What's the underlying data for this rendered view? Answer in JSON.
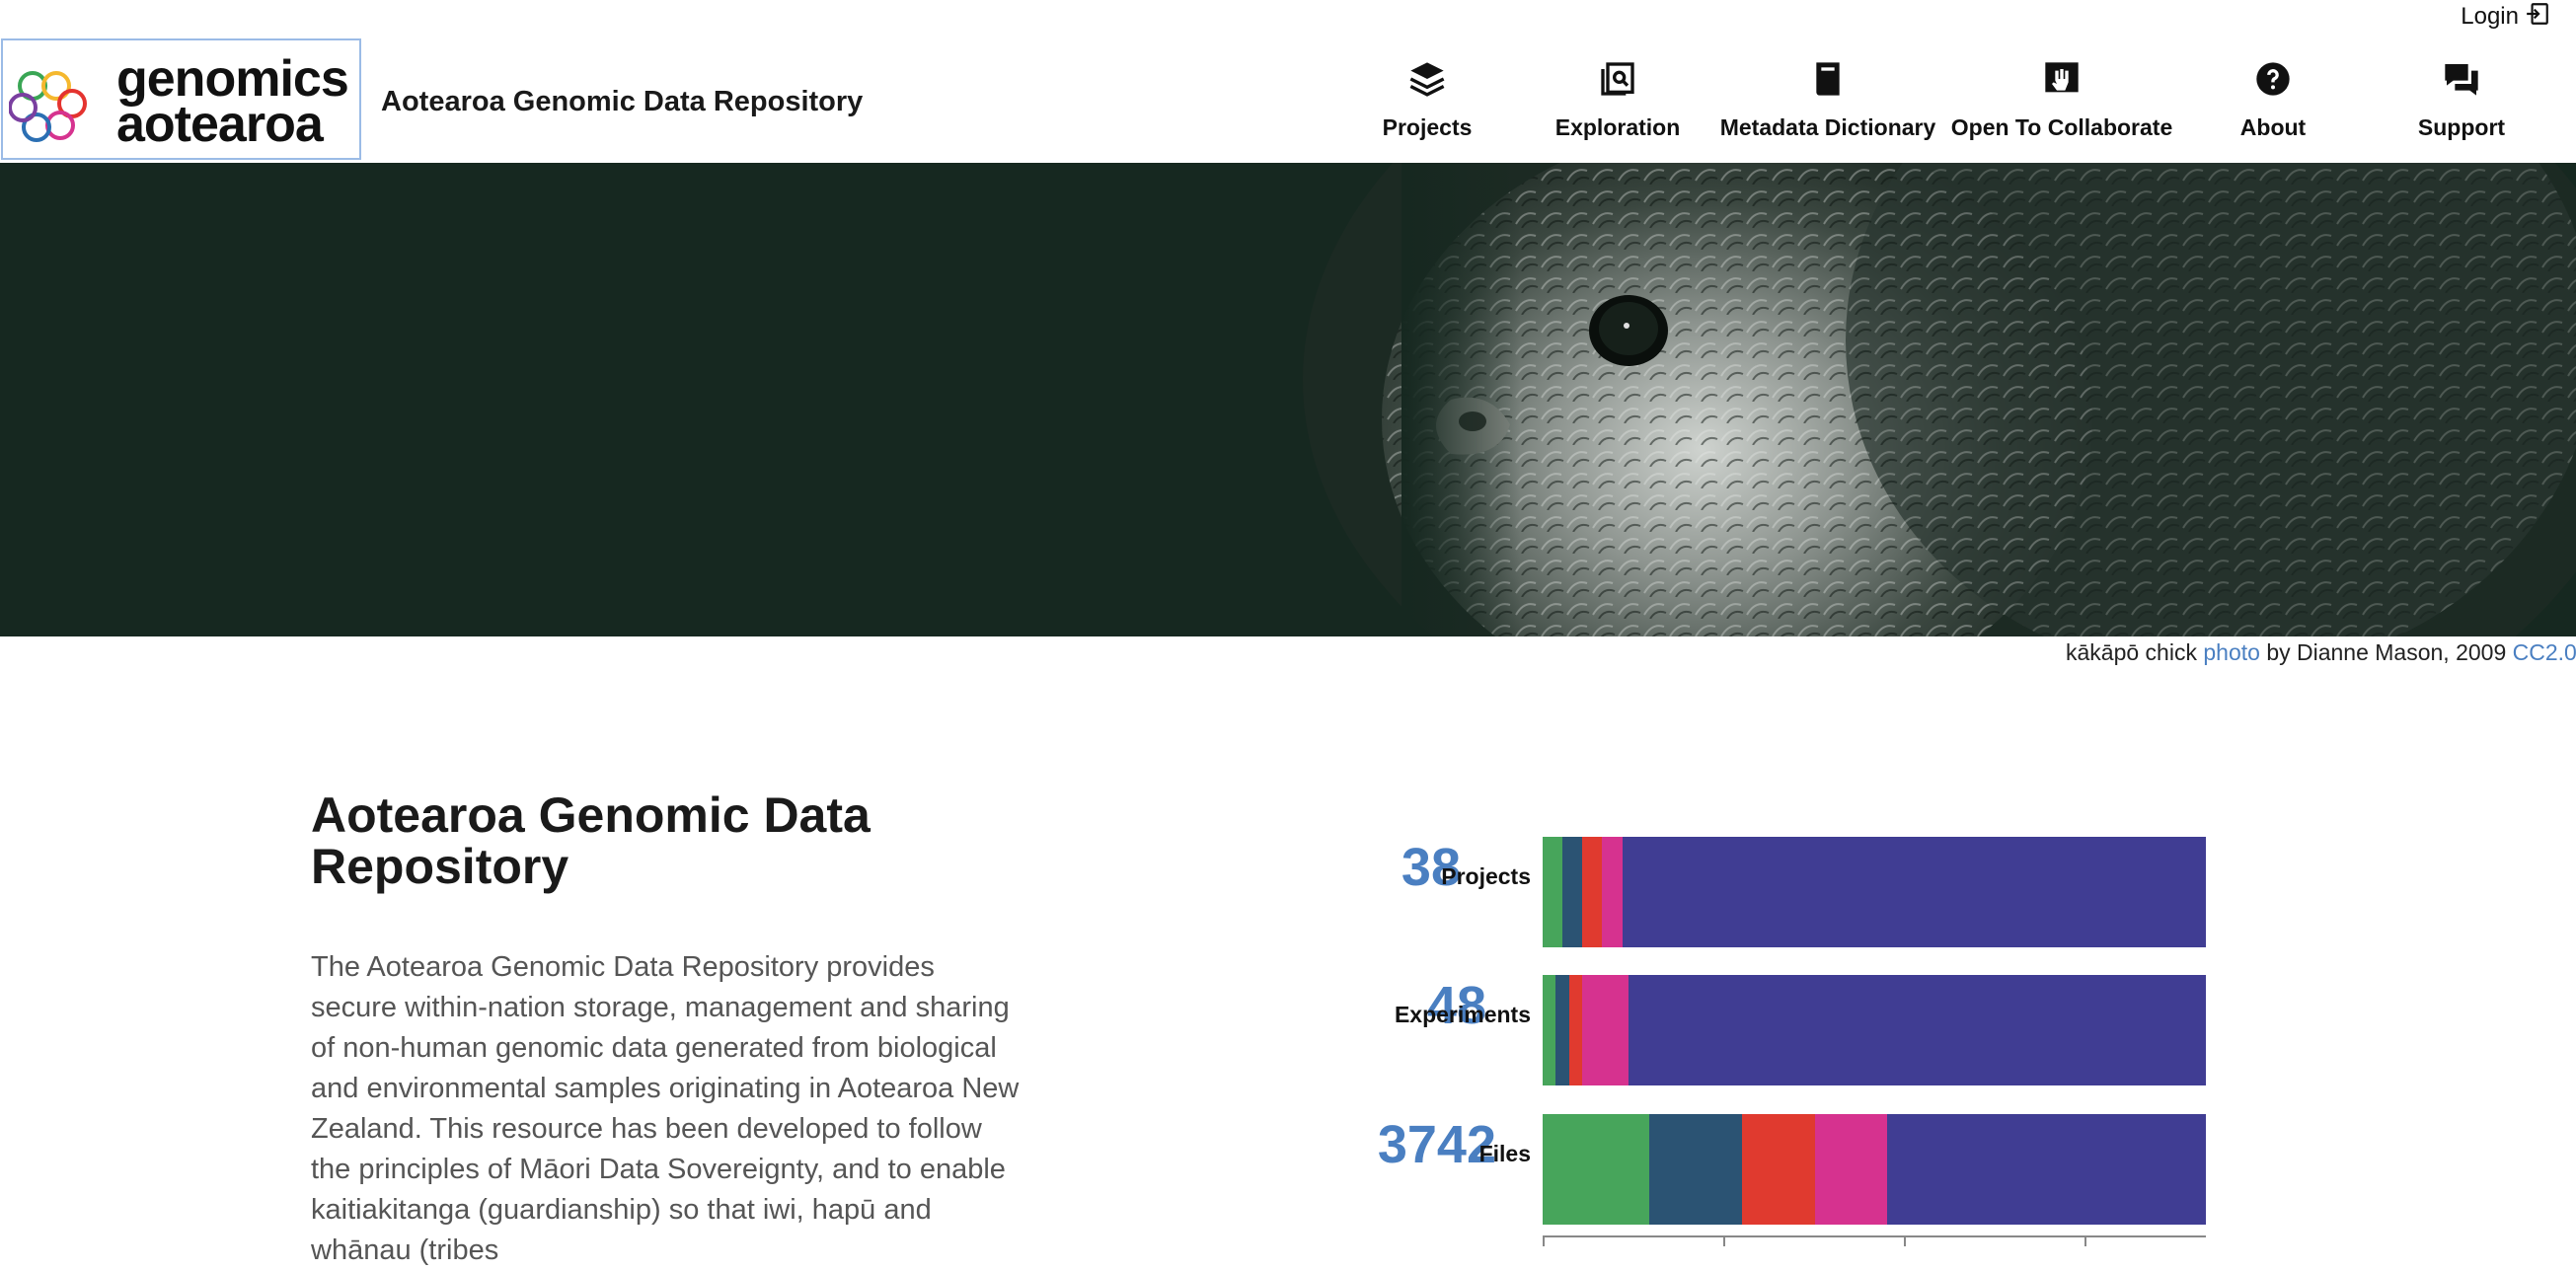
{
  "topbar": {
    "login_label": "Login",
    "login_icon": "login-arrow-icon"
  },
  "logo": {
    "line1": "genomics",
    "line2": "aotearoa",
    "ring_colors": [
      "#3aa655",
      "#f5b82e",
      "#e4332f",
      "#d6338f",
      "#2b6fb3",
      "#7a3fa0"
    ]
  },
  "site_title": "Aotearoa Genomic Data Repository",
  "nav": [
    {
      "label": "Projects",
      "icon": "layers-icon"
    },
    {
      "label": "Exploration",
      "icon": "search-document-icon"
    },
    {
      "label": "Metadata Dictionary",
      "icon": "book-icon"
    },
    {
      "label": "Open To Collaborate",
      "icon": "oc-notice-icon"
    },
    {
      "label": "About",
      "icon": "help-circle-icon"
    },
    {
      "label": "Support",
      "icon": "chat-bubbles-icon"
    }
  ],
  "hero": {
    "image": "kakapo-chick-photo",
    "background": "#162820"
  },
  "credit": {
    "prefix": "kākāpō chick",
    "link_photo": "photo",
    "middle": "by Dianne Mason, 2009",
    "link_license": "CC2.0"
  },
  "main": {
    "title": "Aotearoa Genomic Data Repository",
    "description": "The Aotearoa Genomic Data Repository provides secure within-nation storage, management and sharing of non-human genomic data generated from biological and environmental samples originating in Aotearoa New Zealand. This resource has been developed to follow the principles of Māori Data Sovereignty, and to enable kaitiakitanga (guardianship) so that iwi, hapū and whānau (tribes"
  },
  "colors": {
    "accent": "#4a7fc1",
    "green": "#47a55b",
    "teal": "#2b5373",
    "red": "#e03a2f",
    "magenta": "#d6328f",
    "indigo": "#403d93"
  },
  "chart_data": {
    "type": "bar",
    "orientation": "horizontal-stacked-percent",
    "categories": [
      "Projects",
      "Experiments",
      "Files"
    ],
    "totals": [
      38,
      48,
      3742
    ],
    "segment_colors": [
      "#47a55b",
      "#2b5373",
      "#e03a2f",
      "#d6328f",
      "#403d93"
    ],
    "shares": [
      [
        0.03,
        0.03,
        0.03,
        0.03,
        0.88
      ],
      [
        0.02,
        0.02,
        0.02,
        0.07,
        0.87
      ],
      [
        0.16,
        0.14,
        0.11,
        0.11,
        0.48
      ]
    ],
    "xlim": [
      0,
      1
    ]
  }
}
